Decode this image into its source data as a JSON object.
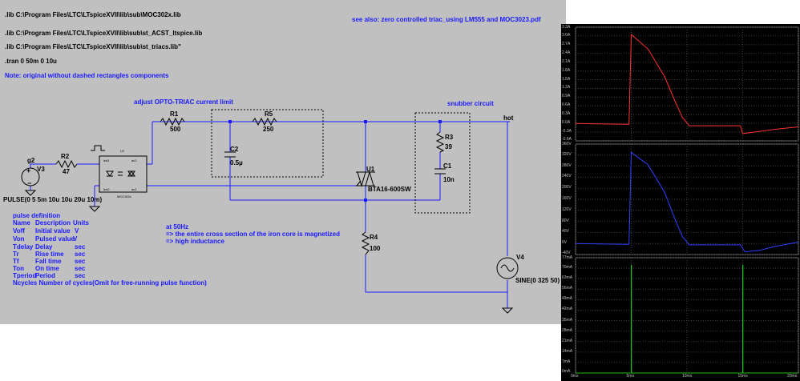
{
  "schematic": {
    "directives": [
      ".lib C:\\Program Files\\LTC\\LTspiceXVII\\lib\\sub\\MOC302x.lib",
      ".lib C:\\Program Files\\LTC\\LTspiceXVII\\lib\\sub\\st_ACST_ltspice.lib",
      ".lib C:\\Program Files\\LTC\\LTspiceXVII\\lib\\sub\\st_triacs.lib\"",
      ".tran 0 50m 0 10u"
    ],
    "note": "Note: original without dashed rectangles components",
    "see_also": "see also: zero controlled triac_using LM555 and MOC3023.pdf",
    "adjust_label": "adjust  OPTO-TRIAC current limit",
    "snubber_label": "snubber circuit",
    "hot_label": "hot",
    "components": {
      "r1_name": "R1",
      "r1_value": "500",
      "r5_name": "R5",
      "r5_value": "250",
      "r2_name": "R2",
      "r2_value": "47",
      "r3_name": "R3",
      "r3_value": "39",
      "r4_name": "R4",
      "r4_value": "100",
      "c1_name": "C1",
      "c1_value": "10n",
      "c2_name": "C2",
      "c2_value": "0.5µ",
      "u1_name": "U1",
      "u1_value": "BTA16-600SW",
      "v3_name": "V3",
      "v3_net": "g2",
      "v3_value": "PULSE(0 5 5m 10u 10u 20u 10m)",
      "v4_name": "V4",
      "v4_value": "SINE(0 325 50)",
      "opto_ref": "U2",
      "opto_part": "MOC302x",
      "opto_pins": [
        "led1",
        "ac2",
        "led2",
        "ac1"
      ]
    },
    "pulse_def": {
      "title": "pulse definition",
      "rows": [
        [
          "Name",
          "Description",
          "Units"
        ],
        [
          "Voff",
          "Initial value",
          "V"
        ],
        [
          "Von",
          "Pulsed value",
          "V"
        ],
        [
          "Tdelay",
          "Delay",
          "sec"
        ],
        [
          "Tr",
          "Rise time",
          "sec"
        ],
        [
          "Tf",
          "Fall time",
          "sec"
        ],
        [
          "Ton",
          "On time",
          "sec"
        ],
        [
          "Tperiod",
          "Period",
          "sec"
        ]
      ],
      "ncycles": "Ncycles Number of cycles(Omit for free-running pulse function)"
    },
    "freq_note": [
      "at  50Hz",
      "=> the entire cross section of the iron core is magnetized",
      "=> high inductance"
    ]
  },
  "chart_data": [
    {
      "type": "line",
      "title": "",
      "yticks": [
        "3.3A",
        "3.0A",
        "2.7A",
        "2.4A",
        "2.1A",
        "1.8A",
        "1.5A",
        "1.2A",
        "0.9A",
        "0.6A",
        "0.3A",
        "0.0A",
        "-0.3A",
        "-0.6A"
      ],
      "ylim": [
        -0.6,
        3.3
      ],
      "series": [
        {
          "color": "#ff3030",
          "x": [
            0,
            2.5,
            4.8,
            5.0,
            6.5,
            8.0,
            9.0,
            9.6,
            10.2,
            14.8,
            15.0,
            16,
            18,
            20
          ],
          "y": [
            0.0,
            -0.02,
            -0.03,
            3.05,
            2.55,
            1.6,
            0.7,
            0.2,
            -0.08,
            -0.08,
            -0.35,
            -0.3,
            -0.2,
            -0.12
          ]
        }
      ],
      "xlim": [
        0,
        20
      ]
    },
    {
      "type": "line",
      "title": "",
      "yticks": [
        "360V",
        "320V",
        "280V",
        "240V",
        "200V",
        "160V",
        "120V",
        "80V",
        "40V",
        "0V",
        "-40V"
      ],
      "ylim": [
        -40,
        360
      ],
      "series": [
        {
          "color": "#3040ff",
          "x": [
            0,
            2.5,
            4.8,
            5.0,
            6.5,
            8.0,
            9.0,
            9.6,
            10.2,
            14.8,
            15.2,
            16.5,
            18,
            20
          ],
          "y": [
            0,
            -2,
            -3,
            330,
            285,
            185,
            80,
            25,
            -5,
            -5,
            -30,
            -25,
            -10,
            5
          ]
        }
      ],
      "xlim": [
        0,
        20
      ]
    },
    {
      "type": "line",
      "title": "",
      "yticks": [
        "77mA",
        "70mA",
        "63mA",
        "56mA",
        "49mA",
        "42mA",
        "35mA",
        "28mA",
        "21mA",
        "14mA",
        "7mA",
        "0mA"
      ],
      "ylim": [
        0,
        77
      ],
      "xticks": [
        "0ms",
        "5ms",
        "10ms",
        "15ms",
        "20ms"
      ],
      "series": [
        {
          "color": "#20c020",
          "x": [
            0,
            5.0,
            5.0,
            5.02,
            5.02,
            15.0,
            15.0,
            15.02,
            15.02,
            20
          ],
          "y": [
            0,
            0,
            72,
            72,
            0,
            0,
            72,
            72,
            0,
            0
          ]
        }
      ],
      "xlim": [
        0,
        20
      ]
    }
  ]
}
